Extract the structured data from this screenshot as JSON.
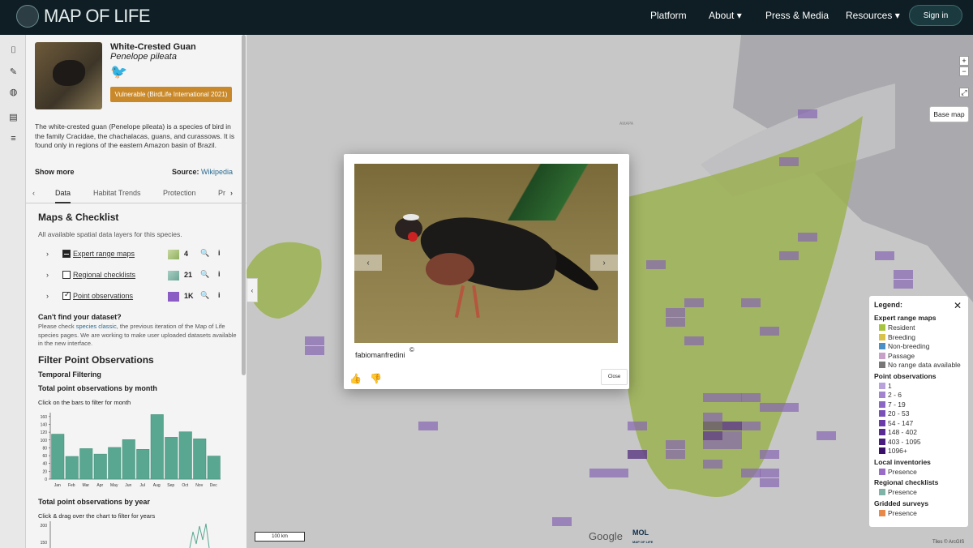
{
  "header": {
    "logo_text": "MAP OF LIFE",
    "nav": [
      "Platform",
      "About ▾",
      "Press & Media",
      "Resources ▾"
    ],
    "signin": "Sign in"
  },
  "species": {
    "common_name": "White-Crested Guan",
    "latin_name": "Penelope pileata",
    "status_badge": "Vulnerable (BirdLife International 2021)",
    "description": "The white-crested guan (Penelope pileata) is a species of bird in the family Cracidae, the chachalacas, guans, and curassows. It is found only in regions of the eastern Amazon basin of Brazil.",
    "show_more": "Show more",
    "source_label": "Source:",
    "source_link": "Wikipedia"
  },
  "tabs": {
    "items": [
      "Data",
      "Habitat Trends",
      "Protection",
      "Pr"
    ]
  },
  "maps_checklist": {
    "title": "Maps & Checklist",
    "subtitle": "All available spatial data layers for this species.",
    "layers": [
      {
        "label": "Expert range maps",
        "count": "4",
        "swatch": "#b5c98a",
        "checkbox": "partial"
      },
      {
        "label": "Regional checklists",
        "count": "21",
        "swatch": "#7fb3a8",
        "checkbox": "off"
      },
      {
        "label": "Point observations",
        "count": "1K",
        "swatch": "#8a5cc4",
        "checkbox": "on"
      }
    ]
  },
  "cant_find": {
    "title": "Can't find your dataset?",
    "text_before": "Please check ",
    "link": "species classic",
    "text_after": ", the previous iteration of the Map of Life species pages. We are working to make user uploaded datasets available in the new interface."
  },
  "filter": {
    "title": "Filter Point Observations",
    "temporal": "Temporal Filtering",
    "month_title": "Total point observations by month",
    "month_sub": "Click on the bars to filter for month",
    "year_title": "Total point observations by year",
    "year_sub": "Click & drag over the chart to filter for years"
  },
  "chart_data": [
    {
      "type": "bar",
      "categories": [
        "Jan",
        "Feb",
        "Mar",
        "Apr",
        "May",
        "Jun",
        "Jul",
        "Aug",
        "Sep",
        "Oct",
        "Nov",
        "Dec"
      ],
      "values": [
        115,
        58,
        78,
        64,
        81,
        101,
        76,
        165,
        107,
        121,
        103,
        59
      ],
      "yticks": [
        "0",
        "20",
        "40",
        "60",
        "80",
        "100",
        "120",
        "140",
        "160"
      ],
      "ylim": [
        0,
        170
      ],
      "color": "#5aa791"
    },
    {
      "type": "line",
      "yticks": [
        "150",
        "200"
      ],
      "color": "#5aa791"
    }
  ],
  "map": {
    "base_map": "Base map",
    "scale": "100 km",
    "google": "Google",
    "mol_label": "MOL",
    "mol_sub": "MAP OF LIFE",
    "tiles": "Tiles © ArcGIS",
    "place_label": "AMAPA",
    "range_color": "#a6c43e",
    "obs_color": "#8a5cc4"
  },
  "legend": {
    "title": "Legend:",
    "sections": [
      {
        "title": "Expert range maps",
        "items": [
          {
            "label": "Resident",
            "color": "#a6c43e"
          },
          {
            "label": "Breeding",
            "color": "#d9c24a"
          },
          {
            "label": "Non-breeding",
            "color": "#4a90c4"
          },
          {
            "label": "Passage",
            "color": "#c8a0c8"
          },
          {
            "label": "No range data available",
            "color": "#777777"
          }
        ]
      },
      {
        "title": "Point observations",
        "items": [
          {
            "label": "1",
            "color": "#b9a1dc"
          },
          {
            "label": "2 - 6",
            "color": "#a283d0"
          },
          {
            "label": "7 - 19",
            "color": "#8c66c4"
          },
          {
            "label": "20 - 53",
            "color": "#7a4fb8"
          },
          {
            "label": "54 - 147",
            "color": "#6a3aa8"
          },
          {
            "label": "148 - 402",
            "color": "#5a2a94"
          },
          {
            "label": "403 - 1095",
            "color": "#4a1c80"
          },
          {
            "label": "1096+",
            "color": "#3a106a"
          }
        ]
      },
      {
        "title": "Local inventories",
        "items": [
          {
            "label": "Presence",
            "color": "#9b6bc8"
          }
        ]
      },
      {
        "title": "Regional checklists",
        "items": [
          {
            "label": "Presence",
            "color": "#7fb3a8"
          }
        ]
      },
      {
        "title": "Gridded surveys",
        "items": [
          {
            "label": "Presence",
            "color": "#e8894a"
          }
        ]
      }
    ]
  },
  "modal": {
    "credit": "fabiomanfredini",
    "copyright": "©",
    "close": "Close",
    "prev": "‹",
    "next": "›"
  }
}
